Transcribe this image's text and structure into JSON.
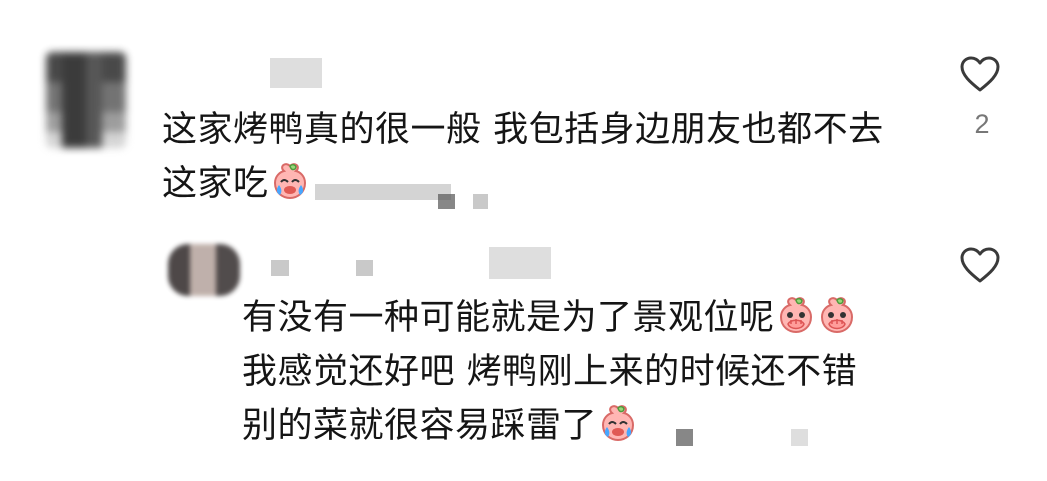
{
  "comment": {
    "line1": "这家烤鸭真的很一般 我包括身边朋友也都不去",
    "line2": "这家吃",
    "likes": "2",
    "emoji": "crying-peach-emoji"
  },
  "reply": {
    "line1": "有没有一种可能就是为了景观位呢",
    "line2": "我感觉还好吧 烤鸭刚上来的时候还不错",
    "line3": "别的菜就很容易踩雷了",
    "emoji_1": "covering-mouth-peach-emoji",
    "emoji_2": "covering-mouth-peach-emoji",
    "emoji_3": "crying-peach-emoji"
  },
  "icons": {
    "comment_like": "heart-outline",
    "reply_like": "heart-outline"
  },
  "colors": {
    "background": "#ffffff",
    "text": "#151515",
    "muted": "#777777"
  }
}
